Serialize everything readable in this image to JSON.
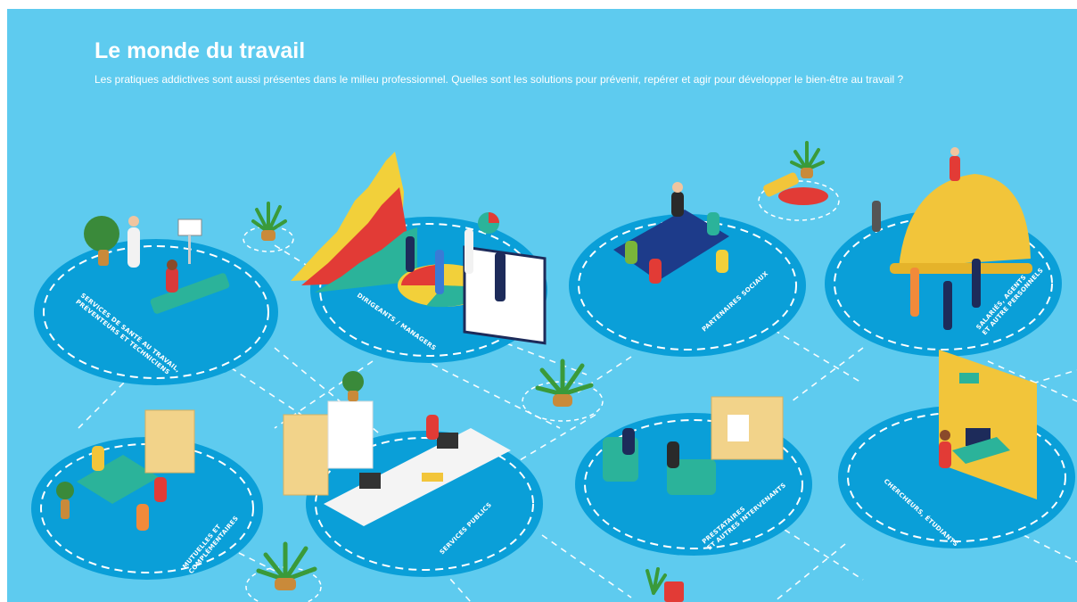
{
  "header": {
    "title": "Le monde du travail",
    "subtitle": "Les pratiques addictives sont aussi présentes dans le milieu professionnel. Quelles sont les solutions pour prévenir, repérer et agir pour développer le bien-être au travail ?"
  },
  "zones": [
    {
      "id": "sante",
      "lines": [
        "SERVICES DE SANTÉ AU TRAVAIL,",
        "PRÉVENTEURS ET TECHNICIENS"
      ]
    },
    {
      "id": "dirigeants",
      "lines": [
        "DIRIGEANTS / MANAGERS"
      ]
    },
    {
      "id": "partenaires",
      "lines": [
        "PARTENAIRES SOCIAUX"
      ]
    },
    {
      "id": "salaries",
      "lines": [
        "SALARIÉS, AGENTS",
        "ET AUTRE PERSONNELS"
      ]
    },
    {
      "id": "mutuelles",
      "lines": [
        "MUTUELLES ET",
        "COMPLÉMENTAIRES"
      ]
    },
    {
      "id": "publics",
      "lines": [
        "SERVICES PUBLICS"
      ]
    },
    {
      "id": "prestataires",
      "lines": [
        "PRESTATAIRES",
        "ET AUTRES INTERVENANTS"
      ]
    },
    {
      "id": "chercheurs",
      "lines": [
        "CHERCHEURS, ÉTUDIANTS"
      ]
    }
  ],
  "colors": {
    "background": "#5ecbef",
    "circle": "#0a9fd8",
    "dash": "#ffffff"
  }
}
